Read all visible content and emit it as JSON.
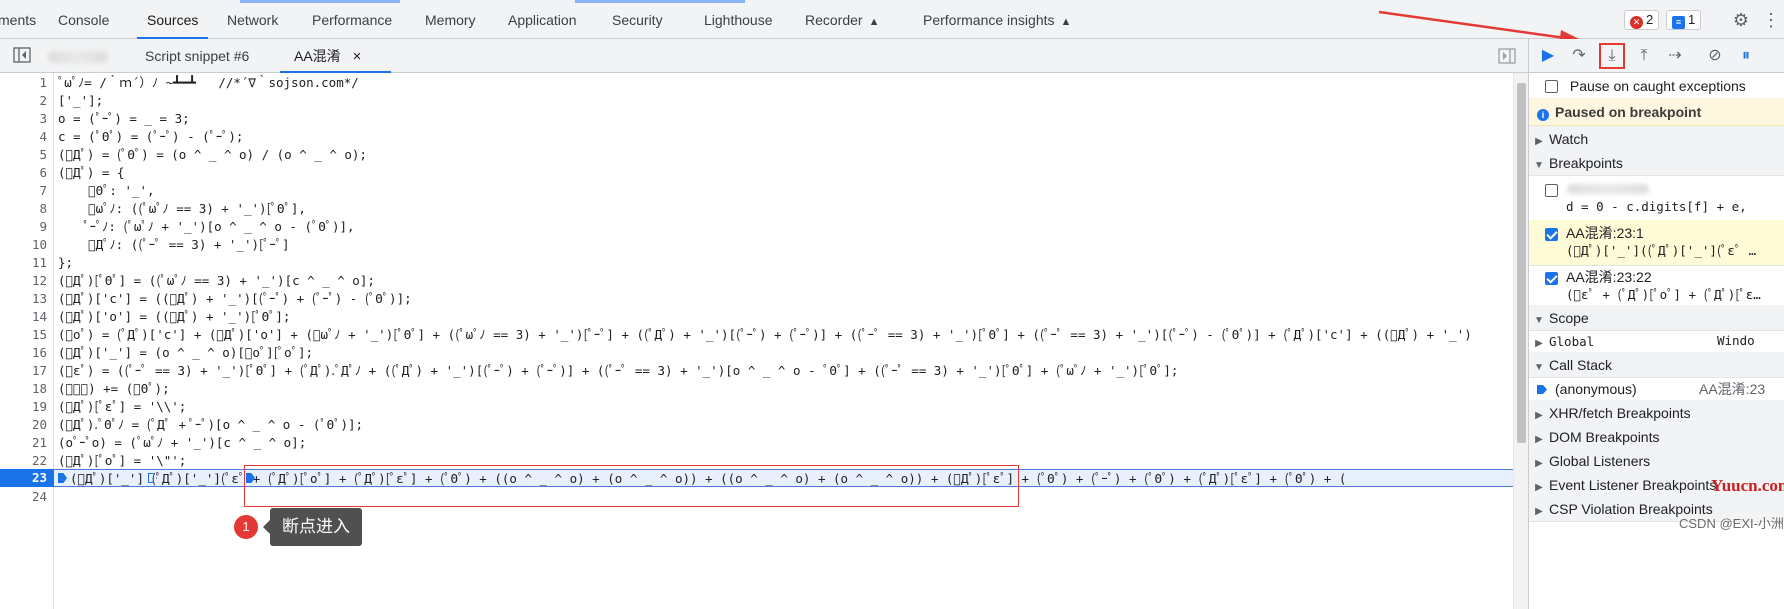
{
  "top_tabs": [
    "ments",
    "Console",
    "Sources",
    "Network",
    "Performance",
    "Memory",
    "Application",
    "Security",
    "Lighthouse",
    "Recorder",
    "Performance insights"
  ],
  "active_tab": "Sources",
  "badges": {
    "errors": "2",
    "messages": "1"
  },
  "editor": {
    "tabs": [
      "Script snippet #6",
      "AA混淆"
    ],
    "close_glyph": "×",
    "lines": [
      "ﾟωﾟﾉ= /｀ｍ´）ﾉ ~┻━┻   //*´∇｀sojson.com*/",
      "['_'];",
      "o = (ﾟｰﾟ) = _ = 3;",
      "c = (ﾟΘﾟ) = (ﾟｰﾟ) - (ﾟｰﾟ);",
      "(ﾟДﾟ) = (ﾟΘﾟ) = (o ^ _ ^ o) / (o ^ _ ^ o);",
      "(ﾟДﾟ) = {",
      "    ﾟΘﾟ: '_',",
      "    ﾟωﾟﾉ: ((ﾟωﾟﾉ == 3) + '_')[ﾟΘﾟ],",
      "    ﾟｰﾟﾉ: (ﾟωﾟﾉ + '_')[o ^ _ ^ o - (ﾟΘﾟ)],",
      "    ﾟДﾟﾉ: ((ﾟｰﾟ == 3) + '_')[ﾟｰﾟ]",
      "};",
      "(ﾟДﾟ)[ﾟΘﾟ] = ((ﾟωﾟﾉ == 3) + '_')[c ^ _ ^ o];",
      "(ﾟДﾟ)['c'] = ((ﾟДﾟ) + '_')[(ﾟｰﾟ) + (ﾟｰﾟ) - (ﾟΘﾟ)];",
      "(ﾟДﾟ)['o'] = ((ﾟДﾟ) + '_')[ﾟΘﾟ];",
      "(ﾟoﾟ) = (ﾟДﾟ)['c'] + (ﾟДﾟ)['o'] + (ﾟωﾟﾉ + '_')[ﾟΘﾟ] + ((ﾟωﾟﾉ == 3) + '_')[ﾟｰﾟ] + ((ﾟДﾟ) + '_')[(ﾟｰﾟ) + (ﾟｰﾟ)] + ((ﾟｰﾟ == 3) + '_')[ﾟΘﾟ] + ((ﾟｰﾟ == 3) + '_')[(ﾟｰﾟ) - (ﾟΘﾟ)] + (ﾟДﾟ)['c'] + ((ﾟДﾟ) + '_')",
      "(ﾟДﾟ)['_'] = (o ^ _ ^ o)[ﾟoﾟ][ﾟoﾟ];",
      "(ﾟεﾟ) = ((ﾟｰﾟ == 3) + '_')[ﾟΘﾟ] + (ﾟДﾟ).ﾟДﾟﾉ + ((ﾟДﾟ) + '_')[(ﾟｰﾟ) + (ﾟｰﾟ)] + ((ﾟｰﾟ == 3) + '_')[o ^ _ ^ o - ﾟΘﾟ] + ((ﾟｰﾟ == 3) + '_')[ﾟΘﾟ] + (ﾟωﾟﾉ + '_')[ﾟΘﾟ];",
      "(ﾟｰﾟ) += (ﾟΘﾟ);",
      "(ﾟДﾟ)[ﾟεﾟ] = '\\\\';",
      "(ﾟДﾟ).ﾟΘﾟﾉ = (ﾟДﾟ + ﾟｰﾟ)[o ^ _ ^ o - (ﾟΘﾟ)];",
      "(oﾟｰﾟo) = (ﾟωﾟﾉ + '_')[c ^ _ ^ o];",
      "(ﾟДﾟ)[ﾟoﾟ] = '\\\"';",
      "(ﾟДﾟ)['_'] (ﾟДﾟ)['_'](ﾟεﾟ + (ﾟДﾟ)[ﾟoﾟ] + (ﾟДﾟ)[ﾟεﾟ] + (ﾟΘﾟ) + ((o ^ _ ^ o) + (o ^ _ ^ o)) + ((o ^ _ ^ o) + (o ^ _ ^ o)) + (ﾟДﾟ)[ﾟεﾟ] + (ﾟΘﾟ) + (ﾟｰﾟ) + (ﾟΘﾟ) + (ﾟДﾟ)[ﾟεﾟ] + (ﾟΘﾟ) + (",
      ""
    ],
    "current_line": "23"
  },
  "annotation": {
    "number": "1",
    "text": "断点进入"
  },
  "debugger": {
    "pause_on_caught": "Pause on caught exceptions",
    "paused_banner": "Paused on breakpoint",
    "sections": {
      "watch": "Watch",
      "breakpoints": "Breakpoints",
      "scope": "Scope",
      "call_stack": "Call Stack",
      "xhr": "XHR/fetch Breakpoints",
      "dom": "DOM Breakpoints",
      "global_listeners": "Global Listeners",
      "event_listener": "Event Listener Breakpoints",
      "csp": "CSP Violation Breakpoints"
    },
    "breakpoints": [
      {
        "title": "",
        "code": "d = 0 - c.digits[f] + e,",
        "checked": false
      },
      {
        "title": "AA混淆:23:1",
        "code": "(ﾟДﾟ)['_']((ﾟДﾟ)['_'](ﾟεﾟ …",
        "checked": true
      },
      {
        "title": "AA混淆:23:22",
        "code": "(ﾟεﾟ + (ﾟДﾟ)[ﾟoﾟ] + (ﾟДﾟ)[ﾟε…",
        "checked": true
      }
    ],
    "scope_global": {
      "name": "Global",
      "value": "Windo"
    },
    "call_stack": [
      {
        "fn": "(anonymous)",
        "loc": "AA混淆:23"
      }
    ]
  },
  "watermarks": {
    "site": "Yuucn.com",
    "credit": "CSDN @EXI-小洲"
  },
  "colors": {
    "accent": "#1a73e8",
    "annotation_red": "#e53935",
    "paused_bg": "#fef7e0"
  }
}
